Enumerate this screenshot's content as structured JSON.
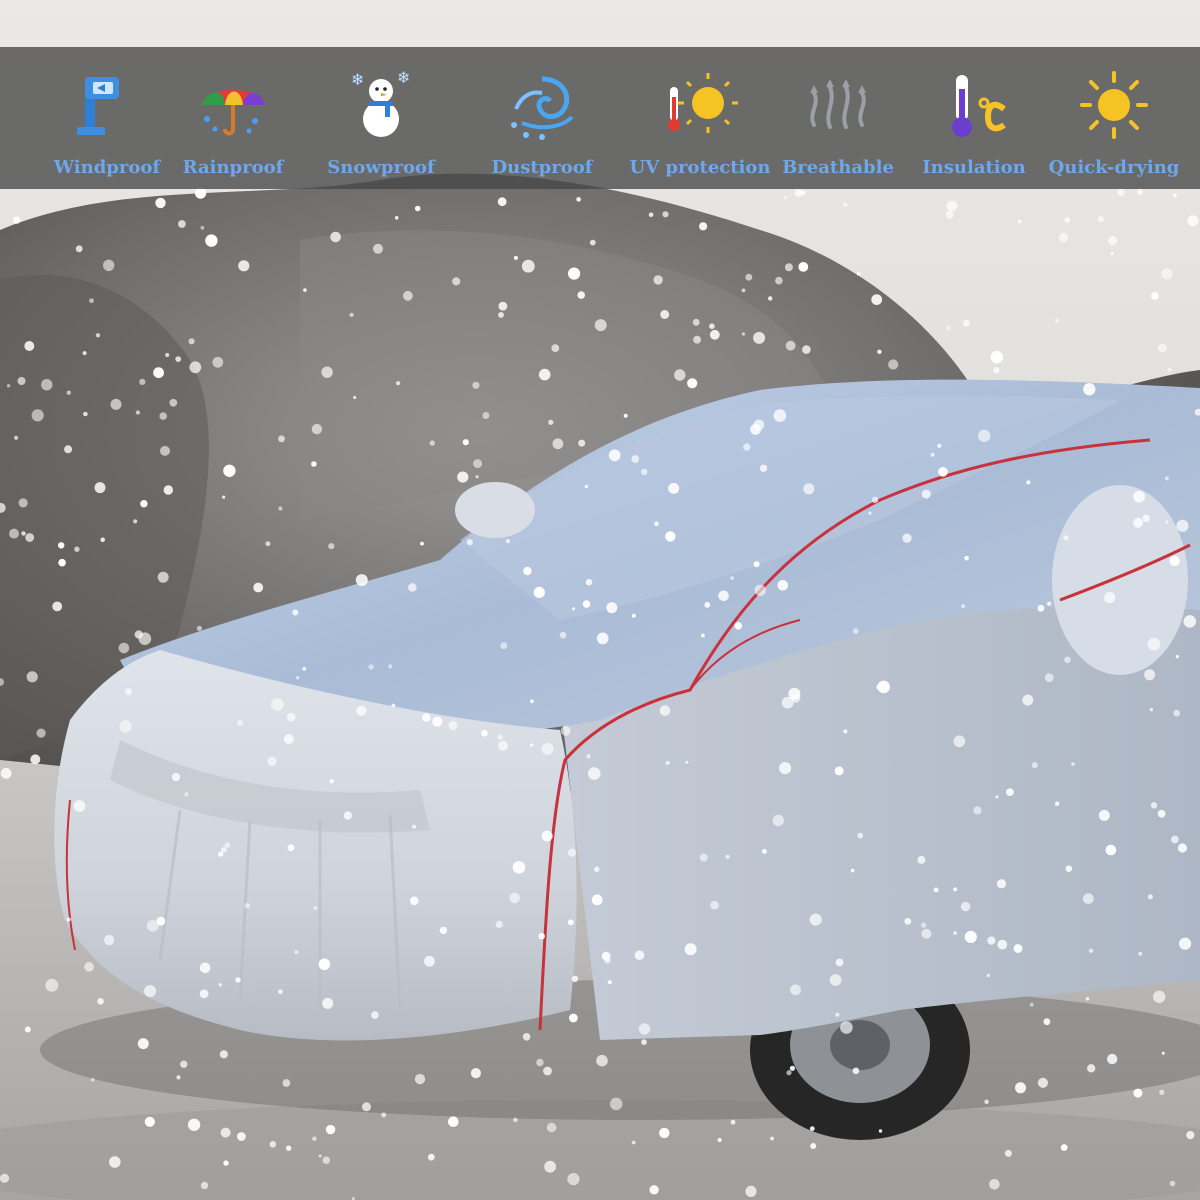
{
  "features": [
    {
      "label": "Windproof",
      "icon": "windproof-icon"
    },
    {
      "label": "Rainproof",
      "icon": "rainproof-icon"
    },
    {
      "label": "Snowproof",
      "icon": "snowproof-icon"
    },
    {
      "label": "Dustproof",
      "icon": "dustproof-icon"
    },
    {
      "label": "UV protection",
      "icon": "uv-protection-icon"
    },
    {
      "label": "Breathable",
      "icon": "breathable-icon"
    },
    {
      "label": "Insulation",
      "icon": "insulation-icon"
    },
    {
      "label": "Quick-drying",
      "icon": "quick-drying-icon"
    }
  ],
  "colors": {
    "label_text": "#6ea8ea",
    "banner_overlay": "#464646",
    "cover_silver": "#c9ced6",
    "seam_red": "#c8323c",
    "sun_yellow": "#f6c325"
  }
}
